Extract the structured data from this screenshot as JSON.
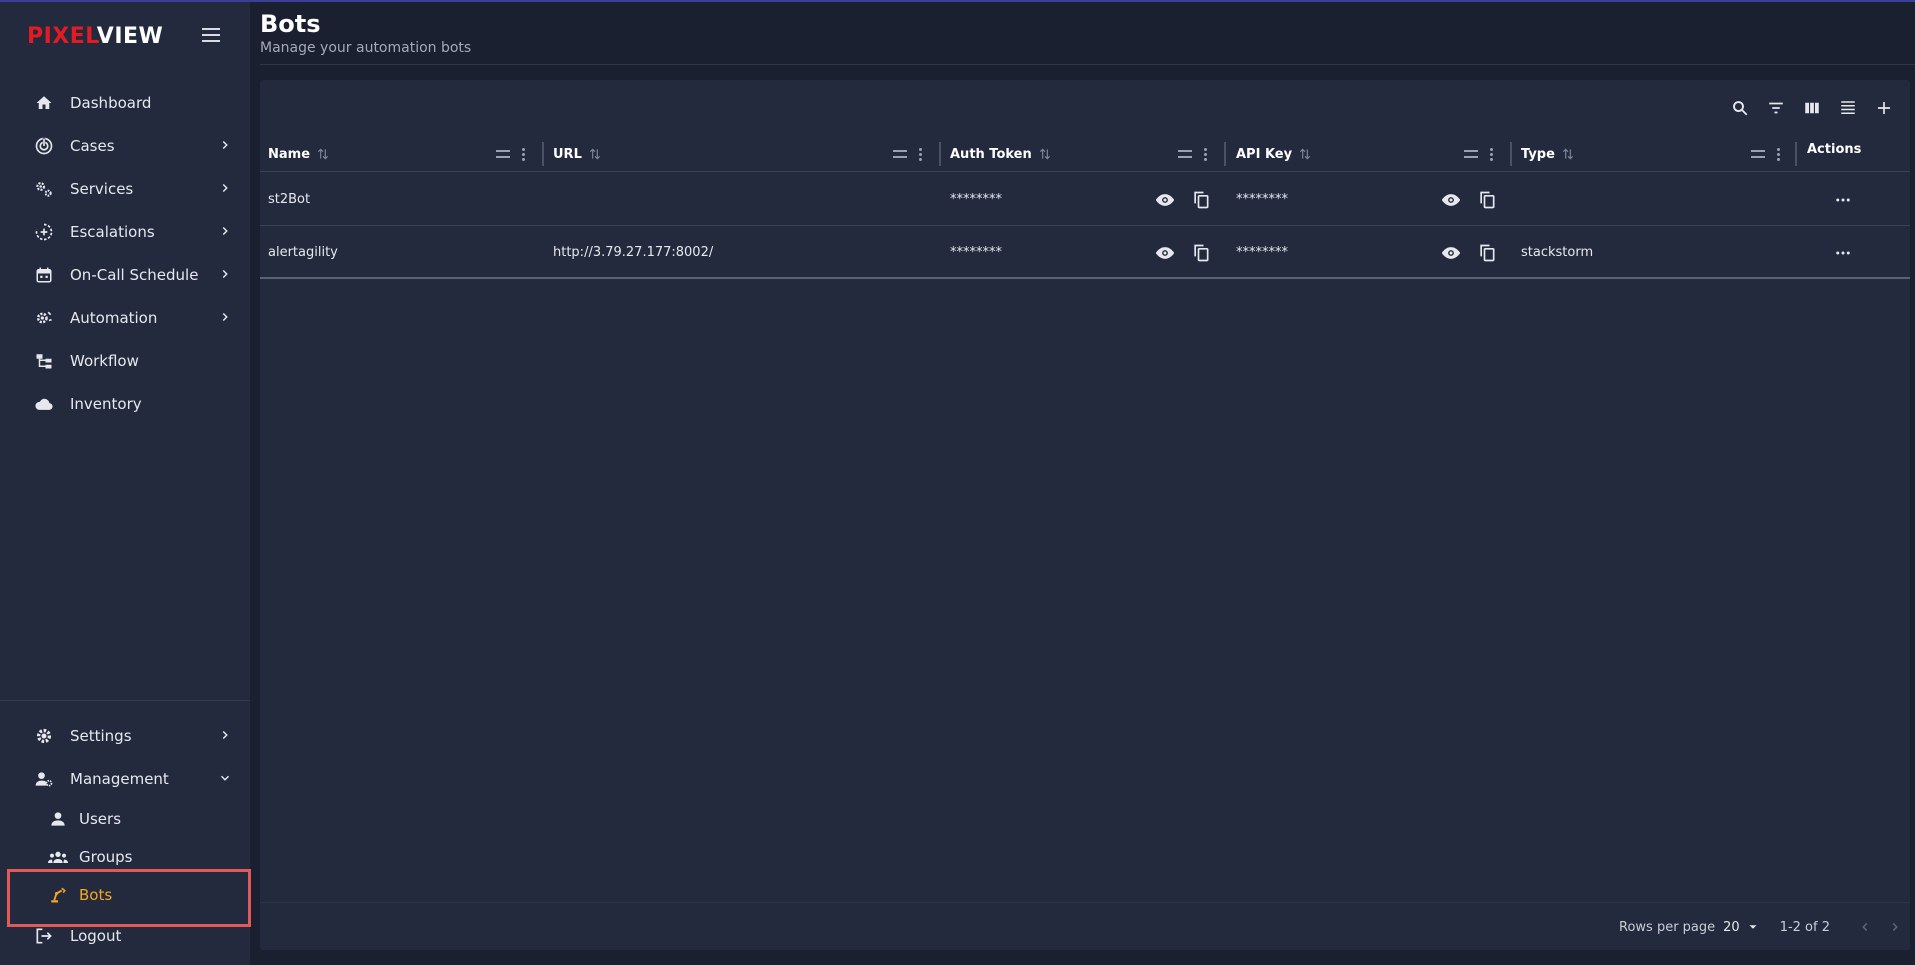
{
  "brand": {
    "part1": "PIXEL",
    "part2": "VIEW"
  },
  "sidebar": {
    "items": [
      {
        "label": "Dashboard"
      },
      {
        "label": "Cases"
      },
      {
        "label": "Services"
      },
      {
        "label": "Escalations"
      },
      {
        "label": "On-Call Schedule"
      },
      {
        "label": "Automation"
      },
      {
        "label": "Workflow"
      },
      {
        "label": "Inventory"
      }
    ],
    "bottom": {
      "settings": "Settings",
      "management": "Management",
      "users": "Users",
      "groups": "Groups",
      "bots": "Bots",
      "logout": "Logout"
    },
    "active_color": "#f5a623"
  },
  "page": {
    "title": "Bots",
    "subtitle": "Manage your automation bots"
  },
  "table": {
    "columns": {
      "name": "Name",
      "url": "URL",
      "auth_token": "Auth Token",
      "api_key": "API Key",
      "type": "Type",
      "actions": "Actions"
    },
    "rows": [
      {
        "name": "st2Bot",
        "url": "",
        "auth_token": "********",
        "api_key": "********",
        "type": ""
      },
      {
        "name": "alertagility",
        "url": "http://3.79.27.177:8002/",
        "auth_token": "********",
        "api_key": "********",
        "type": "stackstorm"
      }
    ]
  },
  "pagination": {
    "rows_per_page_label": "Rows per page",
    "rows_per_page": "20",
    "range": "1-2 of 2"
  }
}
